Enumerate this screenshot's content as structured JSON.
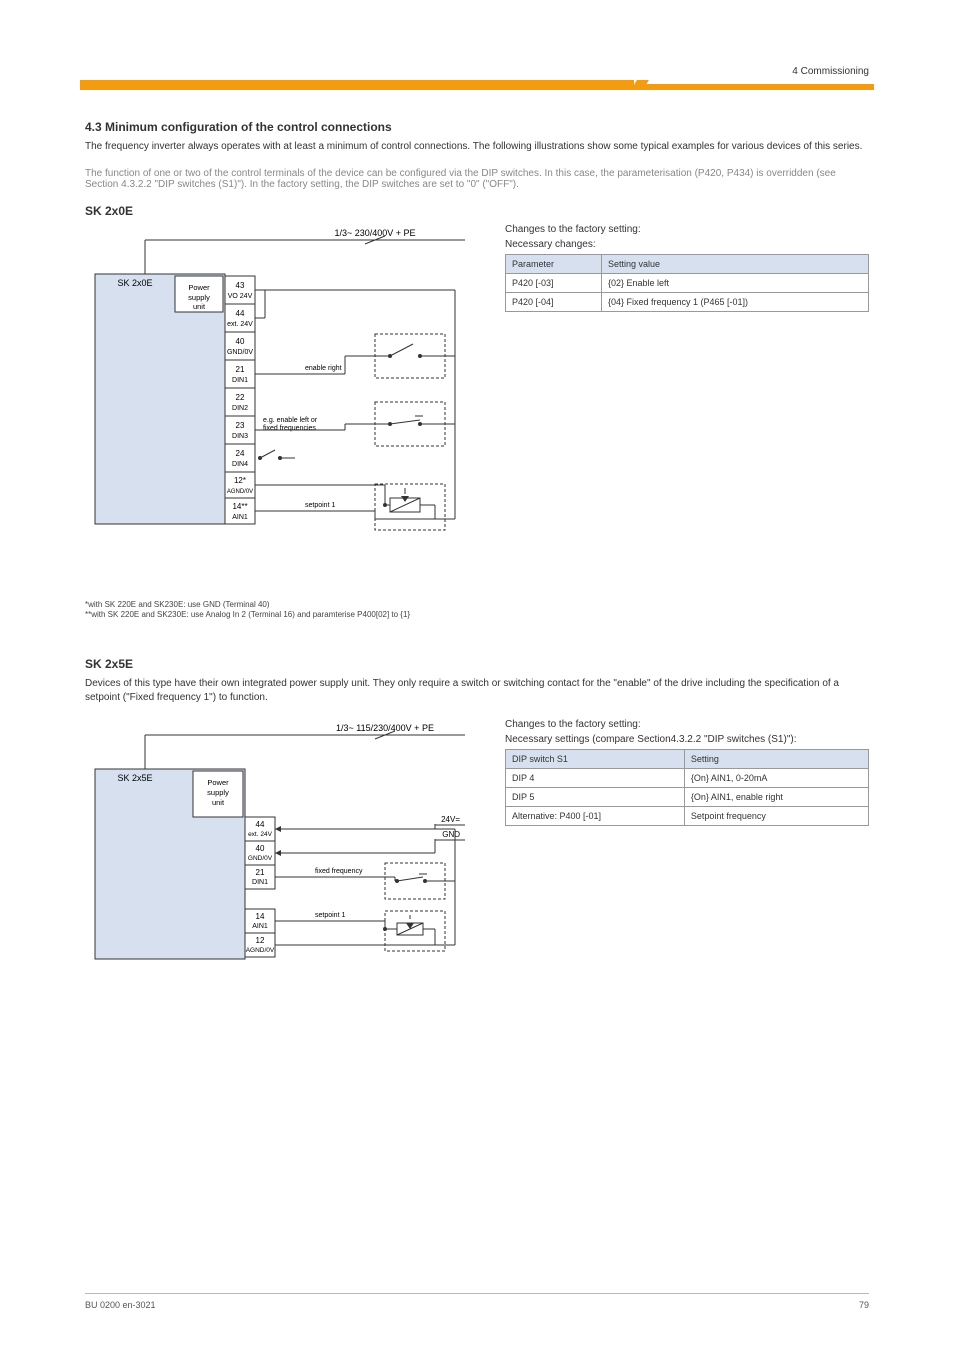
{
  "header": {
    "rightLabel": "4 Commissioning"
  },
  "sections": [
    {
      "title": "4.3 Minimum configuration of the control connections",
      "blurb": "The frequency inverter always operates with at least a minimum of control connections. The following illustrations show some typical examples for various devices of this series.",
      "note": "The function of one or two of the control terminals of the device can be configured via the DIP switches. In this case, the parameterisation (P420, P434) is overridden (see Section 4.3.2.2 \"DIP switches (S1)\"). In the factory setting, the DIP switches are set to \"0\" (\"OFF\").",
      "subTitle": "SK 2x0E",
      "tableLead": "Changes to the factory setting:",
      "tableLead2": "Necessary changes:",
      "columns": [
        "Parameter",
        "Setting value"
      ],
      "rows": [
        [
          "P420 [-03]",
          "{02} Enable left"
        ],
        [
          "P420 [-04]",
          "{04} Fixed frequency 1 (P465 [-01])"
        ]
      ],
      "diagramTop": "1/3~ 230/400V + PE",
      "footnotes": [
        "*with SK 220E and SK230E: use GND (Terminal 40)",
        "**with SK 220E and SK230E: use Analog In 2 (Terminal 16) and paramterise P400[02] to {1}"
      ],
      "chart_data": {
        "type": "diagram",
        "device": "SK 2x0E",
        "power_inlet": "1/3~ 230/400V + PE",
        "terminals": [
          {
            "id": "43",
            "label": "VO 24V"
          },
          {
            "id": "44",
            "label": "ext. 24V"
          },
          {
            "id": "40",
            "label": "GND/0V"
          },
          {
            "id": "21",
            "label": "DIN1",
            "icon": "switch-no",
            "note": "enable right"
          },
          {
            "id": "22",
            "label": "DIN2"
          },
          {
            "id": "23",
            "label": "DIN3",
            "icon": "switch-nc",
            "note": "e.g. enable left or fixed frequencies"
          },
          {
            "id": "24",
            "label": "DIN4",
            "icon_inline": true
          },
          {
            "id": "12*",
            "label": "AGND/0V",
            "note_star": "*"
          },
          {
            "id": "14**",
            "label": "AIN1",
            "icon": "potentiometer",
            "note": "setpoint 1",
            "note_star": "**"
          }
        ]
      }
    },
    {
      "title": "SK 2x5E",
      "blurb": "Devices of this type have their own integrated power supply unit. They only require a switch or switching contact for the \"enable\" of the drive including the specification of a setpoint (\"Fixed frequency 1\") to function.",
      "tableLead": "Changes to the factory setting:",
      "tableLead2": "Necessary settings (compare Section4.3.2.2 \"DIP switches (S1)\"):",
      "columns": [
        "DIP switch S1",
        "Setting"
      ],
      "rows": [
        [
          "DIP 4",
          "{On} AIN1, 0-20mA"
        ],
        [
          "DIP 5",
          "{On} AIN1, enable right"
        ],
        [
          "Alternative: P400 [-01]",
          "Setpoint frequency"
        ]
      ],
      "diagramTop": "1/3~ 115/230/400V + PE",
      "chart_data": {
        "type": "diagram",
        "device": "SK 2x5E",
        "power_inlet": "1/3~ 115/230/400V + PE",
        "aux_rails": [
          "24V=",
          "GND"
        ],
        "terminals": [
          {
            "id": "44",
            "label": "ext. 24V"
          },
          {
            "id": "40",
            "label": "GND/0V"
          },
          {
            "id": "21",
            "label": "DIN1",
            "icon": "switch-nc",
            "note": "fixed frequency"
          },
          {
            "id": "14",
            "label": "AIN1",
            "icon": "potentiometer",
            "note": "setpoint 1"
          },
          {
            "id": "12",
            "label": "AGND/0V"
          }
        ]
      }
    }
  ],
  "footer": {
    "left": "BU 0200 en-3021",
    "right": "79"
  }
}
